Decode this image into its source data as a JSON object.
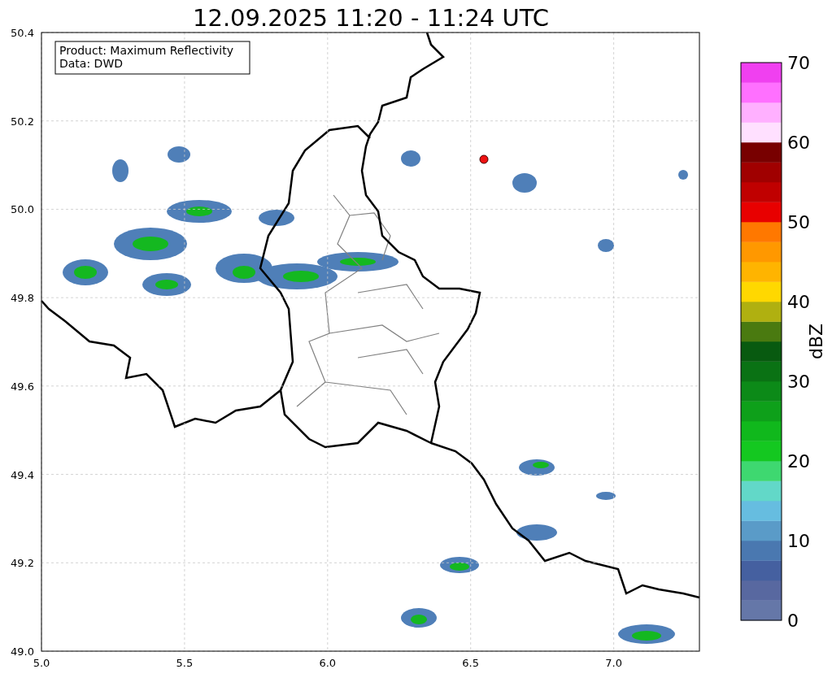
{
  "title": "12.09.2025 11:20 - 11:24 UTC",
  "legend": [
    "Product: Maximum Reflectivity",
    "Data: DWD"
  ],
  "x_ticks": [
    "5.0",
    "5.5",
    "6.0",
    "6.5",
    "7.0"
  ],
  "y_ticks": [
    "50.4",
    "50.2",
    "50.0",
    "49.8",
    "49.6",
    "49.4",
    "49.2",
    "49.0"
  ],
  "colorbar": {
    "label": "dBZ",
    "ticks": [
      "70",
      "60",
      "50",
      "40",
      "30",
      "20",
      "10",
      "0"
    ],
    "segments": [
      {
        "color": "#6577a8"
      },
      {
        "color": "#5868a0"
      },
      {
        "color": "#4560a0"
      },
      {
        "color": "#4a78b0"
      },
      {
        "color": "#5a9bc8"
      },
      {
        "color": "#66bde0"
      },
      {
        "color": "#62d8c8"
      },
      {
        "color": "#3ed870"
      },
      {
        "color": "#14c820"
      },
      {
        "color": "#10b81c"
      },
      {
        "color": "#0ea01a"
      },
      {
        "color": "#0c8a18"
      },
      {
        "color": "#0a7214"
      },
      {
        "color": "#085a10"
      },
      {
        "color": "#4a7a10"
      },
      {
        "color": "#b0b010"
      },
      {
        "color": "#ffd800"
      },
      {
        "color": "#ffb400"
      },
      {
        "color": "#ff9800"
      },
      {
        "color": "#ff7800"
      },
      {
        "color": "#e80000"
      },
      {
        "color": "#c00000"
      },
      {
        "color": "#a00000"
      },
      {
        "color": "#780000"
      },
      {
        "color": "#ffe0ff"
      },
      {
        "color": "#ffb0ff"
      },
      {
        "color": "#ff70ff"
      },
      {
        "color": "#f040f0"
      }
    ]
  }
}
